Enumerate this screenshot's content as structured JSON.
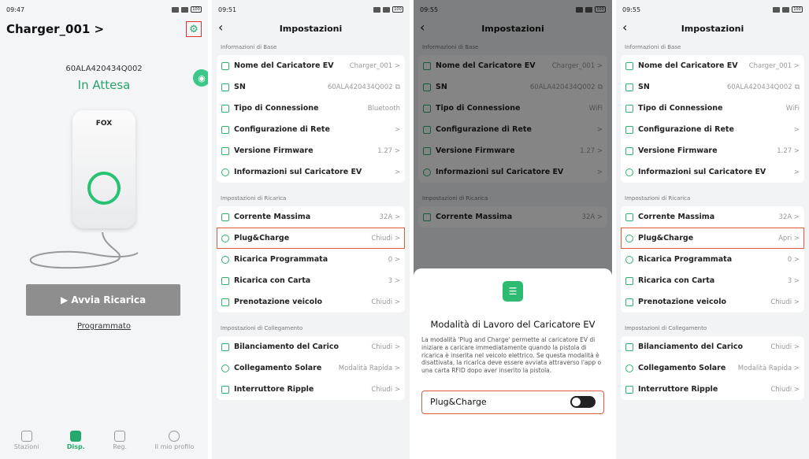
{
  "screen1": {
    "time": "09:47",
    "title": "Charger_001 >",
    "serial": "60ALA420434Q002",
    "status": "In Attesa",
    "logo": "FOX",
    "start_button": "▶  Avvia Ricarica",
    "scheduled_link": "Programmato",
    "tabs": [
      {
        "label": "Stazioni"
      },
      {
        "label": "Disp."
      },
      {
        "label": "Reg."
      },
      {
        "label": "Il mio profilo"
      }
    ],
    "accent_color": "#25a86b"
  },
  "settings_common": {
    "title": "Impostazioni",
    "section_basic": "Informazioni di Base",
    "section_charge": "Impostazioni di Ricarica",
    "section_link": "Impostazioni di Collegamento"
  },
  "screen2": {
    "time": "09:51",
    "basic": [
      {
        "label": "Nome del Caricatore EV",
        "value": "Charger_001 >"
      },
      {
        "label": "SN",
        "value": "60ALA420434Q002"
      },
      {
        "label": "Tipo di Connessione",
        "value": "Bluetooth"
      },
      {
        "label": "Configurazione di Rete",
        "value": ">"
      },
      {
        "label": "Versione Firmware",
        "value": "1.27 >"
      },
      {
        "label": "Informazioni sul Caricatore EV",
        "value": ">"
      }
    ],
    "charge": [
      {
        "label": "Corrente Massima",
        "value": "32A >"
      },
      {
        "label": "Plug&Charge",
        "value": "Chiudi >"
      },
      {
        "label": "Ricarica Programmata",
        "value": "0 >"
      },
      {
        "label": "Ricarica con Carta",
        "value": "3 >"
      },
      {
        "label": "Prenotazione veicolo",
        "value": "Chiudi >"
      }
    ],
    "link": [
      {
        "label": "Bilanciamento del Carico",
        "value": "Chiudi >"
      },
      {
        "label": "Collegamento Solare",
        "value": "Modalità Rapida >"
      },
      {
        "label": "Interruttore Ripple",
        "value": "Chiudi >"
      }
    ]
  },
  "screen3": {
    "time": "09:55",
    "basic": [
      {
        "label": "Nome del Caricatore EV",
        "value": "Charger_001 >"
      },
      {
        "label": "SN",
        "value": "60ALA420434Q002"
      },
      {
        "label": "Tipo di Connessione",
        "value": "WiFi"
      },
      {
        "label": "Configurazione di Rete",
        "value": ">"
      },
      {
        "label": "Versione Firmware",
        "value": "1.27 >"
      },
      {
        "label": "Informazioni sul Caricatore EV",
        "value": ">"
      }
    ],
    "charge_first": {
      "label": "Corrente Massima",
      "value": "32A >"
    },
    "modal": {
      "title": "Modalità di Lavoro del Caricatore EV",
      "description": "La modalità 'Plug and Charge' permette al caricatore EV di iniziare a caricare immediatamente quando la pistola di ricarica è inserita nel veicolo elettrico. Se questa modalità è disattivata, la ricarica deve essere avviata attraverso l'app o una carta RFID dopo aver inserito la pistola.",
      "toggle_label": "Plug&Charge"
    }
  },
  "screen4": {
    "time": "09:55",
    "basic": [
      {
        "label": "Nome del Caricatore EV",
        "value": "Charger_001 >"
      },
      {
        "label": "SN",
        "value": "60ALA420434Q002"
      },
      {
        "label": "Tipo di Connessione",
        "value": "WiFi"
      },
      {
        "label": "Configurazione di Rete",
        "value": ">"
      },
      {
        "label": "Versione Firmware",
        "value": "1.27 >"
      },
      {
        "label": "Informazioni sul Caricatore EV",
        "value": ">"
      }
    ],
    "charge": [
      {
        "label": "Corrente Massima",
        "value": "32A >"
      },
      {
        "label": "Plug&Charge",
        "value": "Apri >"
      },
      {
        "label": "Ricarica Programmata",
        "value": "0 >"
      },
      {
        "label": "Ricarica con Carta",
        "value": "3 >"
      },
      {
        "label": "Prenotazione veicolo",
        "value": "Chiudi >"
      }
    ],
    "link": [
      {
        "label": "Bilanciamento del Carico",
        "value": "Chiudi >"
      },
      {
        "label": "Collegamento Solare",
        "value": "Modalità Rapida >"
      },
      {
        "label": "Interruttore Ripple",
        "value": "Chiudi >"
      }
    ]
  }
}
